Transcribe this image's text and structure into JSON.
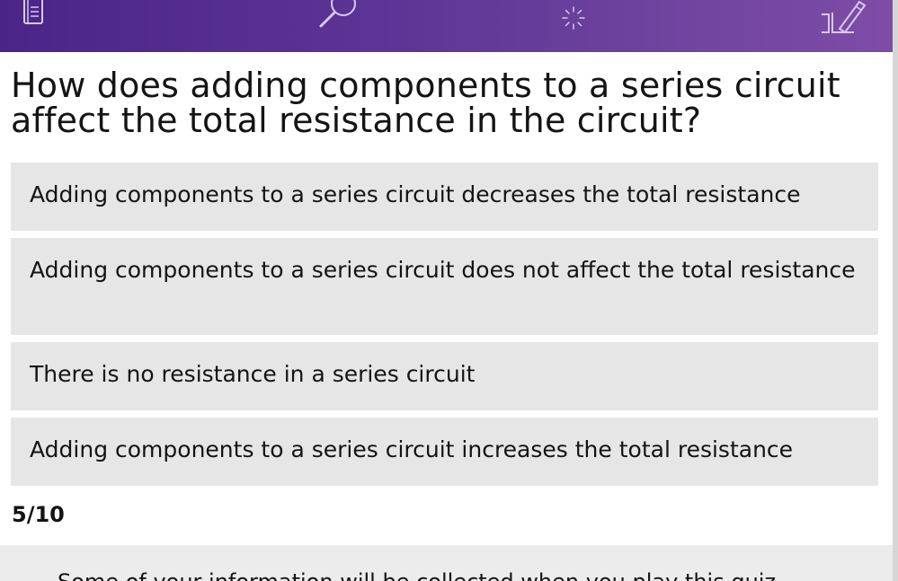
{
  "header": {
    "icons": [
      "notebook-icon",
      "magnifier-icon",
      "spark-icon",
      "pen-icon"
    ],
    "gradient_colors": [
      "#4a2587",
      "#7d4ca6"
    ]
  },
  "quiz": {
    "question": "How does adding components to a series circuit affect the total resistance in the circuit?",
    "answers": [
      "Adding components to a series circuit decreases the total resistance",
      "Adding components to a series circuit does not affect the total resistance",
      "There is no resistance in a series circuit",
      "Adding components to a series circuit increases the total resistance"
    ],
    "progress": "5/10"
  },
  "notice": {
    "text": "Some of your information will be collected when you play this quiz"
  },
  "colors": {
    "answer_background": "#e6e6e6",
    "notice_background": "#ececec",
    "text": "#141414"
  }
}
